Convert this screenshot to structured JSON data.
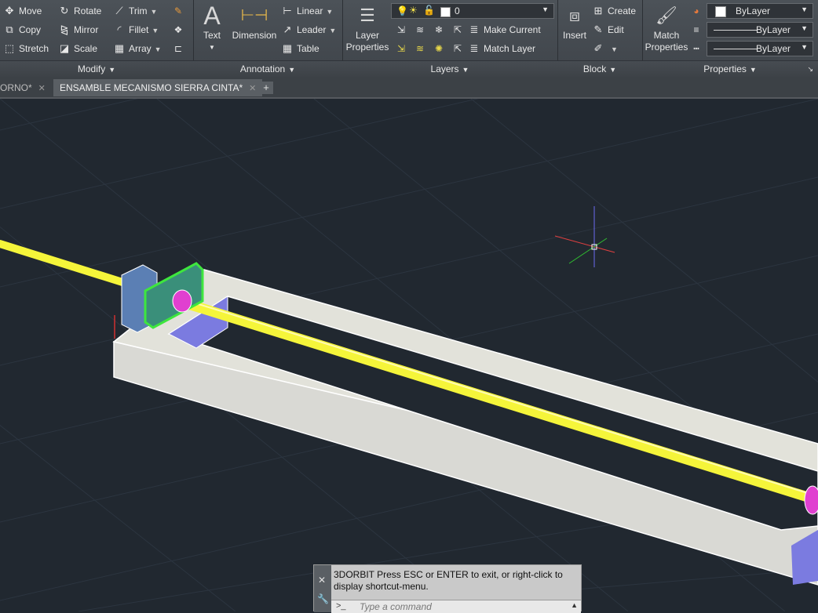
{
  "ribbon": {
    "modify": {
      "title": "Modify",
      "tools": [
        "Move",
        "Copy",
        "Stretch",
        "Rotate",
        "Mirror",
        "Scale",
        "Trim",
        "Fillet",
        "Array"
      ]
    },
    "annotation": {
      "title": "Annotation",
      "text_label": "Text",
      "dimension_label": "Dimension",
      "linear_label": "Linear",
      "leader_label": "Leader",
      "table_label": "Table"
    },
    "layers": {
      "title": "Layers",
      "layer_properties_line1": "Layer",
      "layer_properties_line2": "Properties",
      "current_layer": "0",
      "make_current_label": "Make Current",
      "match_layer_label": "Match Layer"
    },
    "block": {
      "title": "Block",
      "insert_label": "Insert",
      "create_label": "Create",
      "edit_label": "Edit"
    },
    "properties": {
      "title": "Properties",
      "match_properties_line1": "Match",
      "match_properties_line2": "Properties",
      "color_value": "ByLayer",
      "linetype_value": "ByLayer",
      "lineweight_value": "ByLayer"
    }
  },
  "tabs": [
    {
      "label": "ORNO*"
    },
    {
      "label": "ENSAMBLE MECANISMO SIERRA CINTA*"
    }
  ],
  "command": {
    "message": "3DORBIT Press ESC or ENTER to exit, or right-click to display shortcut-menu.",
    "placeholder": "Type a command",
    "prompt_symbol": ">_"
  }
}
